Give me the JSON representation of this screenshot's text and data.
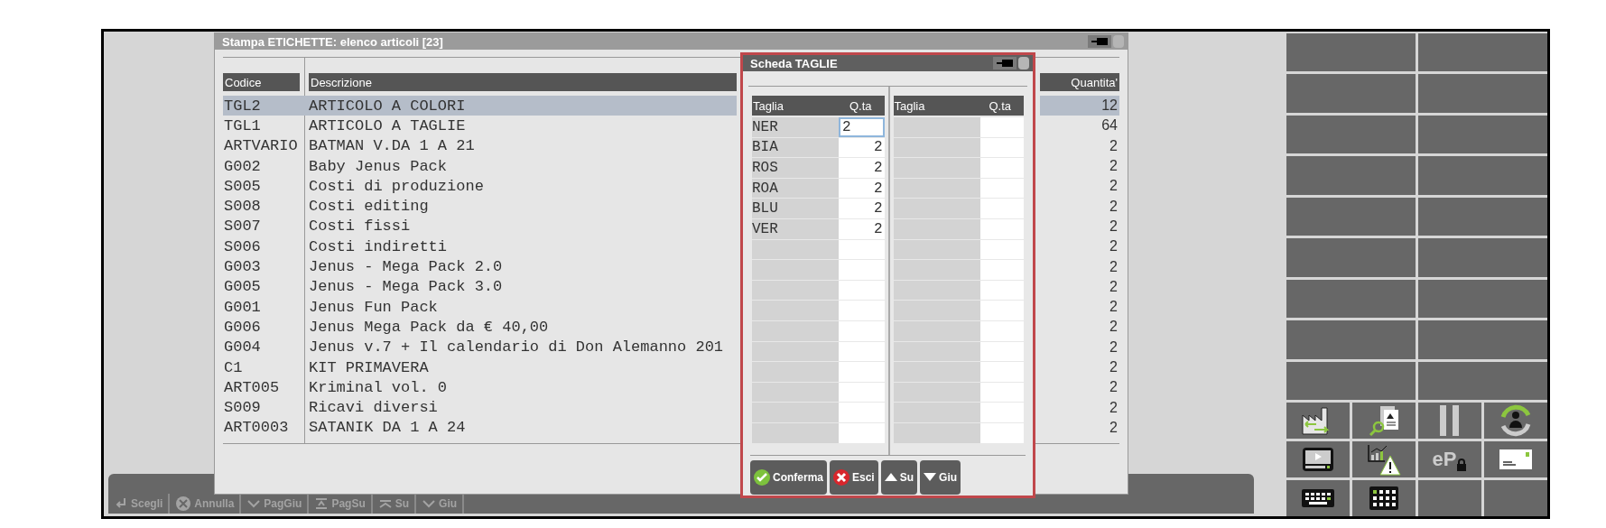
{
  "list_window": {
    "title": "Stampa ETICHETTE: elenco articoli [23]",
    "columns": [
      "Codice",
      "Descrizione",
      "Quantita'"
    ],
    "rows": [
      {
        "code": "TGL2",
        "description": "ARTICOLO A COLORI",
        "quantity": "12",
        "selected": true
      },
      {
        "code": "TGL1",
        "description": "ARTICOLO A TAGLIE",
        "quantity": "64",
        "selected": false
      },
      {
        "code": "ARTVARIO",
        "description": "BATMAN V.DA 1 A 21",
        "quantity": "2",
        "selected": false
      },
      {
        "code": "G002",
        "description": "Baby Jenus Pack",
        "quantity": "2",
        "selected": false
      },
      {
        "code": "S005",
        "description": "Costi di produzione",
        "quantity": "2",
        "selected": false
      },
      {
        "code": "S008",
        "description": "Costi editing",
        "quantity": "2",
        "selected": false
      },
      {
        "code": "S007",
        "description": "Costi fissi",
        "quantity": "2",
        "selected": false
      },
      {
        "code": "S006",
        "description": "Costi indiretti",
        "quantity": "2",
        "selected": false
      },
      {
        "code": "G003",
        "description": "Jenus - Mega Pack 2.0",
        "quantity": "2",
        "selected": false
      },
      {
        "code": "G005",
        "description": "Jenus - Mega Pack 3.0",
        "quantity": "2",
        "selected": false
      },
      {
        "code": "G001",
        "description": "Jenus Fun Pack",
        "quantity": "2",
        "selected": false
      },
      {
        "code": "G006",
        "description": "Jenus Mega Pack da € 40,00",
        "quantity": "2",
        "selected": false
      },
      {
        "code": "G004",
        "description": "Jenus v.7 + Il calendario di Don Alemanno 201",
        "quantity": "2",
        "selected": false
      },
      {
        "code": "C1",
        "description": "KIT PRIMAVERA",
        "quantity": "2",
        "selected": false
      },
      {
        "code": "ART005",
        "description": "Kriminal vol. 0",
        "quantity": "2",
        "selected": false
      },
      {
        "code": "S009",
        "description": "Ricavi diversi",
        "quantity": "2",
        "selected": false
      },
      {
        "code": "ART0003",
        "description": "SATANIK DA 1 A 24",
        "quantity": "2",
        "selected": false
      }
    ]
  },
  "sizes_window": {
    "title": "Scheda TAGLIE",
    "panels": [
      {
        "columns": [
          "Taglia",
          "Q.ta"
        ],
        "rows": [
          {
            "size": "NER",
            "qty": "2",
            "focused": true
          },
          {
            "size": "BIA",
            "qty": "2",
            "focused": false
          },
          {
            "size": "ROS",
            "qty": "2",
            "focused": false
          },
          {
            "size": "ROA",
            "qty": "2",
            "focused": false
          },
          {
            "size": "BLU",
            "qty": "2",
            "focused": false
          },
          {
            "size": "VER",
            "qty": "2",
            "focused": false
          }
        ]
      },
      {
        "columns": [
          "Taglia",
          "Q.ta"
        ]
      }
    ],
    "buttons": [
      {
        "kind": "confirm",
        "label": "Conferma"
      },
      {
        "kind": "exit",
        "label": "Esci"
      },
      {
        "kind": "up",
        "label": "Su"
      },
      {
        "kind": "down",
        "label": "Giu"
      }
    ]
  },
  "toolbar": [
    {
      "kind": "choose",
      "label": "Scegli"
    },
    {
      "kind": "cancel",
      "label": "Annulla"
    },
    {
      "kind": "pagedown",
      "label": "PagGiu"
    },
    {
      "kind": "pageup",
      "label": "PagSu"
    },
    {
      "kind": "up",
      "label": "Su"
    },
    {
      "kind": "down",
      "label": "Giu"
    }
  ],
  "side_panel": {
    "logo_text": "eP"
  }
}
